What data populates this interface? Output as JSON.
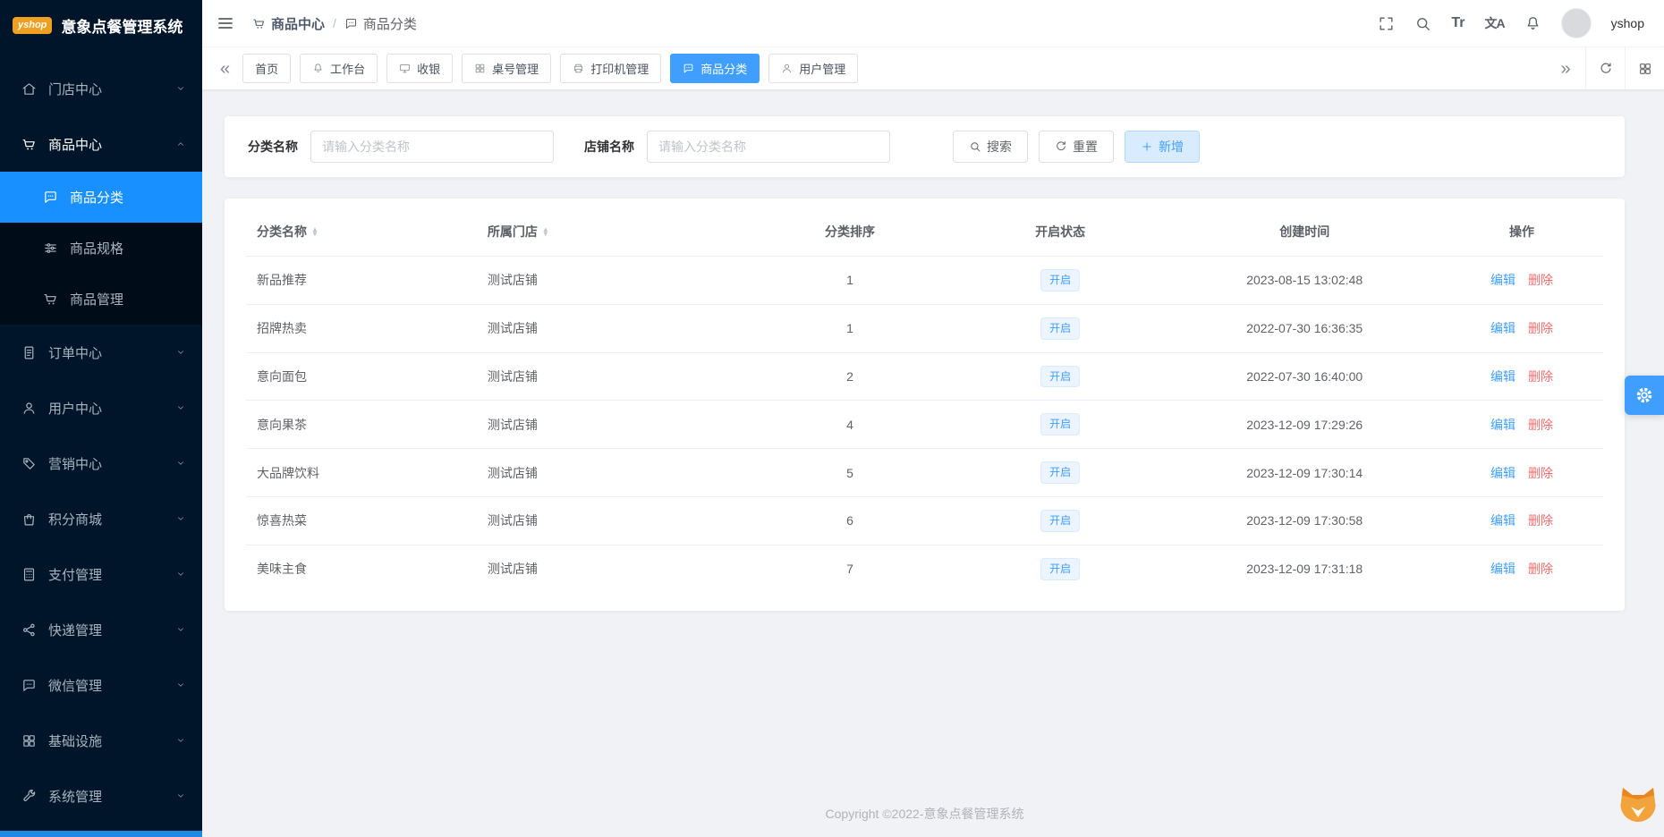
{
  "app": {
    "logo_badge": "yshop",
    "title": "意象点餐管理系统",
    "copyright": "Copyright ©2022-意象点餐管理系统"
  },
  "header": {
    "breadcrumb": [
      {
        "label": "商品中心"
      },
      {
        "label": "商品分类"
      }
    ],
    "separator": "/",
    "username": "yshop"
  },
  "tabbar": {
    "tabs": [
      {
        "label": "首页"
      },
      {
        "label": "工作台"
      },
      {
        "label": "收银"
      },
      {
        "label": "桌号管理"
      },
      {
        "label": "打印机管理"
      },
      {
        "label": "商品分类"
      },
      {
        "label": "用户管理"
      }
    ]
  },
  "sidebar": {
    "items": [
      {
        "label": "门店中心"
      },
      {
        "label": "商品中心",
        "children": [
          {
            "label": "商品分类"
          },
          {
            "label": "商品规格"
          },
          {
            "label": "商品管理"
          }
        ]
      },
      {
        "label": "订单中心"
      },
      {
        "label": "用户中心"
      },
      {
        "label": "营销中心"
      },
      {
        "label": "积分商城"
      },
      {
        "label": "支付管理"
      },
      {
        "label": "快递管理"
      },
      {
        "label": "微信管理"
      },
      {
        "label": "基础设施"
      },
      {
        "label": "系统管理"
      }
    ]
  },
  "filters": {
    "category_label": "分类名称",
    "category_placeholder": "请输入分类名称",
    "store_label": "店铺名称",
    "store_placeholder": "请输入分类名称",
    "search_button": "搜索",
    "reset_button": "重置",
    "add_button": "新增"
  },
  "table": {
    "columns": [
      "分类名称",
      "所属门店",
      "分类排序",
      "开启状态",
      "创建时间",
      "操作"
    ],
    "edit_label": "编辑",
    "delete_label": "删除",
    "rows": [
      {
        "name": "新品推荐",
        "store": "测试店铺",
        "sort": "1",
        "status": "开启",
        "created": "2023-08-15 13:02:48"
      },
      {
        "name": "招牌热卖",
        "store": "测试店铺",
        "sort": "1",
        "status": "开启",
        "created": "2022-07-30 16:36:35"
      },
      {
        "name": "意向面包",
        "store": "测试店铺",
        "sort": "2",
        "status": "开启",
        "created": "2022-07-30 16:40:00"
      },
      {
        "name": "意向果茶",
        "store": "测试店铺",
        "sort": "4",
        "status": "开启",
        "created": "2023-12-09 17:29:26"
      },
      {
        "name": "大品牌饮料",
        "store": "测试店铺",
        "sort": "5",
        "status": "开启",
        "created": "2023-12-09 17:30:14"
      },
      {
        "name": "惊喜热菜",
        "store": "测试店铺",
        "sort": "6",
        "status": "开启",
        "created": "2023-12-09 17:30:58"
      },
      {
        "name": "美味主食",
        "store": "测试店铺",
        "sort": "7",
        "status": "开启",
        "created": "2023-12-09 17:31:18"
      }
    ]
  },
  "misc": {
    "font_icon": "Tr",
    "lang_icon": "文A"
  },
  "colors": {
    "accent": "#409eff",
    "sidebar_bg": "#001529",
    "sidebar_active": "#1890ff",
    "danger": "#f56c6c",
    "status_badge_bg": "#ecf5ff",
    "page_bg": "#f0f2f5",
    "logo_badge_bg": "#f0a020"
  }
}
